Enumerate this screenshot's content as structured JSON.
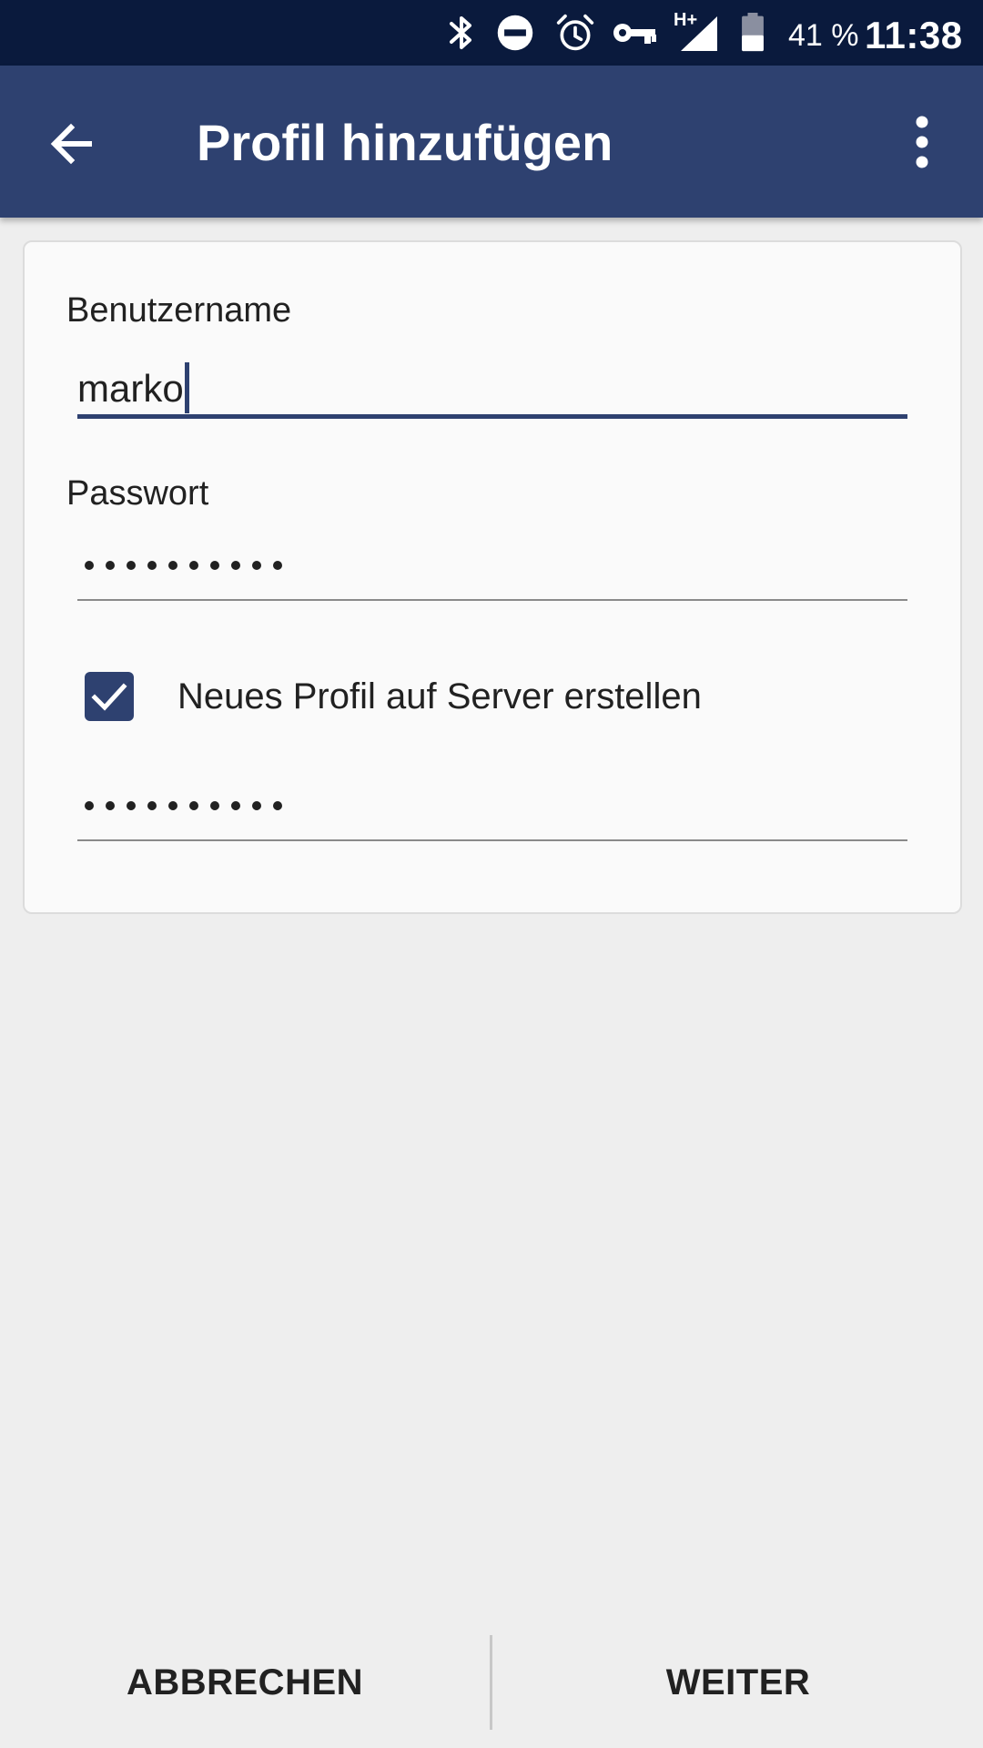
{
  "status_bar": {
    "battery_percent": "41 %",
    "time": "11:38",
    "network_label": "H+",
    "icons": [
      "bluetooth-icon",
      "do-not-disturb-icon",
      "alarm-icon",
      "vpn-key-icon",
      "hplus-network-icon",
      "signal-icon",
      "battery-icon"
    ]
  },
  "app_bar": {
    "title": "Profil hinzufügen",
    "back_icon": "arrow-back-icon",
    "menu_icon": "more-vert-icon"
  },
  "form": {
    "username_label": "Benutzername",
    "username_value": "marko",
    "password_label": "Passwort",
    "password_length": 10,
    "checkbox_label": "Neues Profil auf Server erstellen",
    "checkbox_checked": true,
    "confirm_password_length": 10
  },
  "buttons": {
    "cancel": "ABBRECHEN",
    "next": "WEITER"
  },
  "colors": {
    "status_bar": "#0a1a3d",
    "app_bar": "#2e4170",
    "accent": "#2e4170",
    "background": "#eeeeee",
    "card": "#fafafa"
  }
}
